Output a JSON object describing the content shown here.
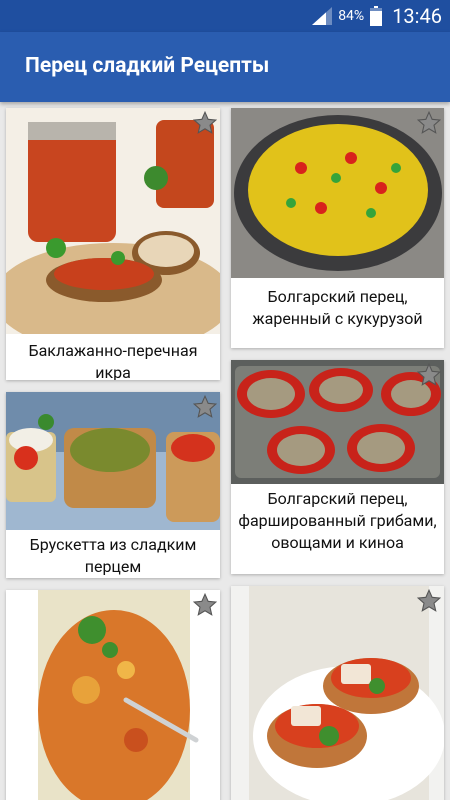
{
  "status_bar": {
    "signal_icon": "cell-signal-icon",
    "battery_percent": "84%",
    "battery_icon": "battery-icon",
    "time": "13:46"
  },
  "app_bar": {
    "title": "Перец сладкий Рецепты"
  },
  "recipes": [
    {
      "title": "Баклажанно-перечная икра",
      "star_icon": "star-icon"
    },
    {
      "title": "Болгарский перец, жаренный с кукурузой",
      "star_icon": "star-icon"
    },
    {
      "title": "Брускетта из сладким перцем",
      "star_icon": "star-icon"
    },
    {
      "title": "Болгарский перец, фаршированный грибами, овощами и киноа",
      "star_icon": "star-icon"
    },
    {
      "title": "",
      "star_icon": "star-icon"
    },
    {
      "title": "",
      "star_icon": "star-icon"
    }
  ],
  "colors": {
    "status_bar": "#1f4fa0",
    "app_bar": "#2a5db0",
    "star_fill": "#8a8a8a"
  }
}
